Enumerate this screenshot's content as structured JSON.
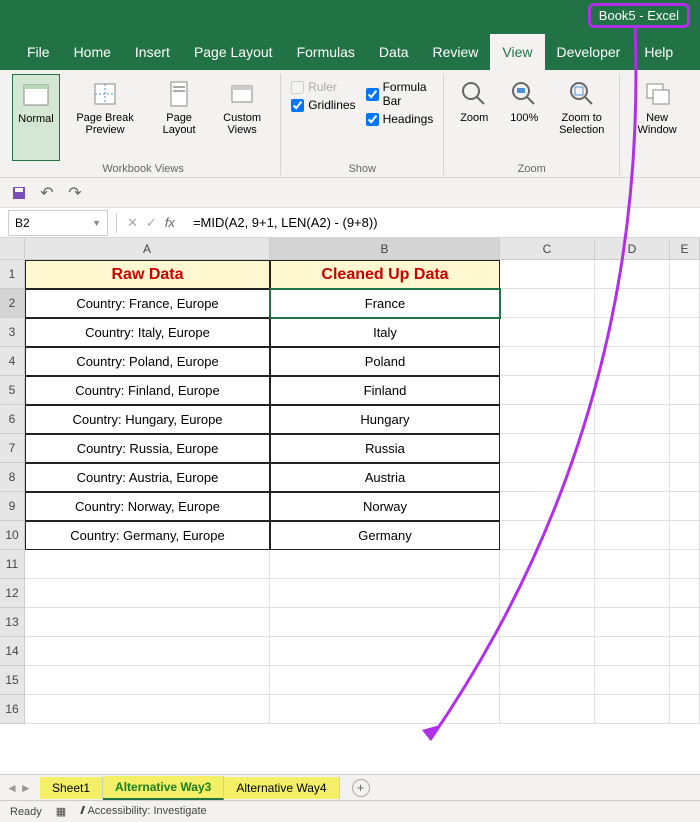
{
  "window_title": "Book5  -  Excel",
  "ribbon_tabs": [
    "File",
    "Home",
    "Insert",
    "Page Layout",
    "Formulas",
    "Data",
    "Review",
    "View",
    "Developer",
    "Help"
  ],
  "active_tab": "View",
  "groups": {
    "views": {
      "label": "Workbook Views",
      "items": [
        {
          "label": "Normal"
        },
        {
          "label": "Page Break Preview"
        },
        {
          "label": "Page Layout"
        },
        {
          "label": "Custom Views"
        }
      ]
    },
    "show": {
      "label": "Show",
      "items": [
        {
          "label": "Ruler",
          "checked": false
        },
        {
          "label": "Gridlines",
          "checked": true
        },
        {
          "label": "Formula Bar",
          "checked": true
        },
        {
          "label": "Headings",
          "checked": true
        }
      ]
    },
    "zoom": {
      "label": "Zoom",
      "items": [
        {
          "label": "Zoom"
        },
        {
          "label": "100%"
        },
        {
          "label": "Zoom to Selection"
        }
      ]
    },
    "window": {
      "items": [
        {
          "label": "New Window"
        }
      ]
    }
  },
  "name_box": "B2",
  "formula": "=MID(A2, 9+1, LEN(A2) - (9+8))",
  "columns": [
    "A",
    "B",
    "C",
    "D",
    "E"
  ],
  "rows": [
    1,
    2,
    3,
    4,
    5,
    6,
    7,
    8,
    9,
    10,
    11,
    12,
    13,
    14,
    15,
    16
  ],
  "selected_cell": {
    "row": 2,
    "col": "B"
  },
  "headers": {
    "A": "Raw Data",
    "B": "Cleaned Up Data"
  },
  "data": [
    {
      "A": "Country: France, Europe",
      "B": "France"
    },
    {
      "A": "Country: Italy, Europe",
      "B": "Italy"
    },
    {
      "A": "Country: Poland, Europe",
      "B": "Poland"
    },
    {
      "A": "Country: Finland, Europe",
      "B": "Finland"
    },
    {
      "A": "Country: Hungary, Europe",
      "B": "Hungary"
    },
    {
      "A": "Country: Russia, Europe",
      "B": "Russia"
    },
    {
      "A": "Country: Austria, Europe",
      "B": "Austria"
    },
    {
      "A": "Country: Norway, Europe",
      "B": "Norway"
    },
    {
      "A": "Country: Germany, Europe",
      "B": "Germany"
    }
  ],
  "sheet_tabs": [
    "Sheet1",
    "Alternative Way3",
    "Alternative Way4"
  ],
  "active_sheet": "Alternative Way3",
  "status_text": "Ready",
  "accessibility": "Accessibility: Investigate"
}
